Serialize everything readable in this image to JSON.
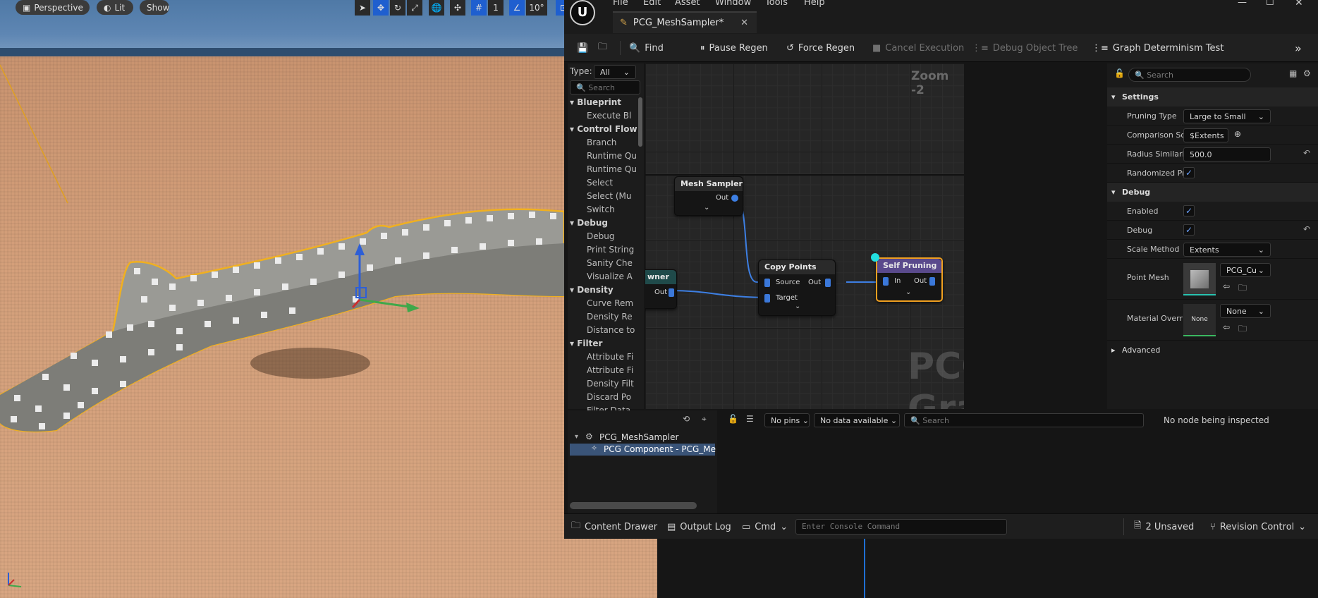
{
  "viewport": {
    "perspective_label": "Perspective",
    "lit_label": "Lit",
    "show_label": "Show",
    "grid_value": "1",
    "angle_value": "10°"
  },
  "menu": [
    "File",
    "Edit",
    "Asset",
    "Window",
    "Tools",
    "Help"
  ],
  "tab": {
    "title": "PCG_MeshSampler*"
  },
  "toolbar": {
    "find": "Find",
    "pause_regen": "Pause Regen",
    "force_regen": "Force Regen",
    "cancel_execution": "Cancel Execution",
    "debug_object_tree": "Debug Object Tree",
    "graph_determinism": "Graph Determinism Test"
  },
  "palette": {
    "type_label": "Type:",
    "type_value": "All",
    "search_placeholder": "Search",
    "categories": [
      {
        "name": "Blueprint",
        "items": [
          "Execute Bl"
        ]
      },
      {
        "name": "Control Flow",
        "items": [
          "Branch",
          "Runtime Qu",
          "Runtime Qu",
          "Select",
          "Select (Mu",
          "Switch"
        ]
      },
      {
        "name": "Debug",
        "items": [
          "Debug",
          "Print String",
          "Sanity Che",
          "Visualize A"
        ]
      },
      {
        "name": "Density",
        "items": [
          "Curve Rem",
          "Density Re",
          "Distance to"
        ]
      },
      {
        "name": "Filter",
        "items": [
          "Attribute Fi",
          "Attribute Fi",
          "Density Filt",
          "Discard Po",
          "Filter Data"
        ]
      }
    ]
  },
  "graph": {
    "zoom_label": "Zoom -2",
    "watermark": "PCG Graph",
    "nodes": {
      "mesh_sampler": {
        "title": "Mesh Sampler",
        "out": "Out"
      },
      "owner": {
        "title": "wner",
        "out": "Out"
      },
      "copy_points": {
        "title": "Copy Points",
        "source": "Source",
        "target": "Target",
        "out": "Out"
      },
      "self_pruning": {
        "title": "Self Pruning",
        "in": "In",
        "out": "Out"
      }
    }
  },
  "details": {
    "search_placeholder": "Search",
    "settings_header": "Settings",
    "pruning_type_label": "Pruning Type",
    "pruning_type_value": "Large to Small",
    "comparison_label": "Comparison Sou...",
    "comparison_value": "$Extents",
    "radius_label": "Radius Similarit...",
    "radius_value": "500.0",
    "randomized_label": "Randomized Pru...",
    "debug_header": "Debug",
    "enabled_label": "Enabled",
    "debug_label": "Debug",
    "scale_method_label": "Scale Method",
    "scale_method_value": "Extents",
    "point_mesh_label": "Point Mesh",
    "point_mesh_value": "PCG_Cu",
    "material_override_label": "Material Override",
    "material_override_thumb": "None",
    "material_override_value": "None",
    "advanced_header": "Advanced"
  },
  "debug_panel": {
    "tree_root": "PCG_MeshSampler",
    "tree_child": "PCG Component - PCG_Me",
    "no_pins": "No pins",
    "no_data": "No data available",
    "search_placeholder": "Search",
    "inspect_status": "No node being inspected"
  },
  "statusbar": {
    "content_drawer": "Content Drawer",
    "output_log": "Output Log",
    "cmd": "Cmd",
    "console_placeholder": "Enter Console Command",
    "unsaved": "2 Unsaved",
    "revision_control": "Revision Control"
  }
}
